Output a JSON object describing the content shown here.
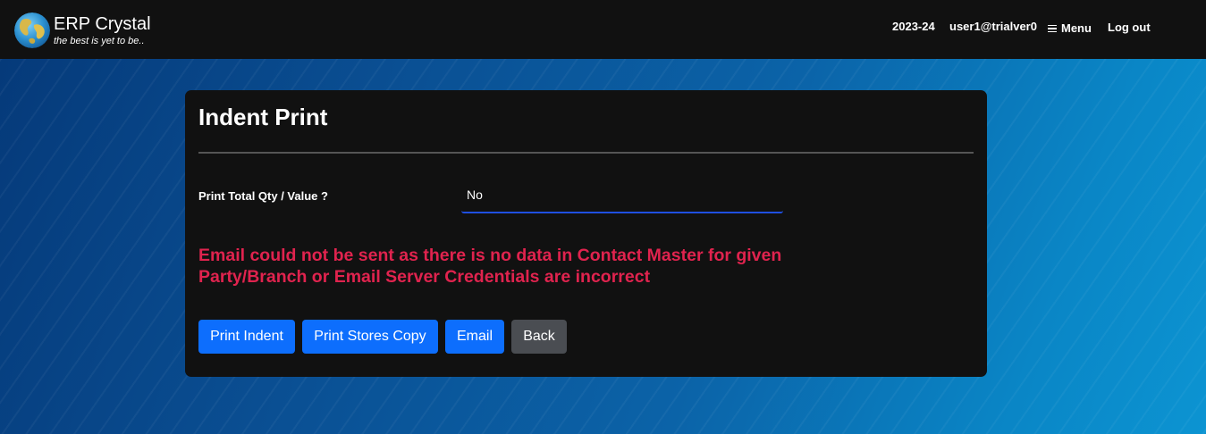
{
  "header": {
    "brand_title": "ERP Crystal",
    "brand_tagline": "the best is yet to be..",
    "logo_icon": "globe-icon",
    "financial_year": "2023-24",
    "user": "user1@trialver0",
    "menu_label": "Menu",
    "menu_icon": "hamburger-icon",
    "logout_label": "Log out"
  },
  "card": {
    "title": "Indent Print",
    "field": {
      "label": "Print Total Qty / Value ?",
      "value": "No"
    },
    "error_message": "Email could not be sent as there is no data in Contact Master for given Party/Branch or Email Server Credentials are incorrect",
    "buttons": {
      "print_indent": "Print Indent",
      "print_stores_copy": "Print Stores Copy",
      "email": "Email",
      "back": "Back"
    }
  },
  "colors": {
    "navbar_bg": "#111111",
    "card_bg": "#111111",
    "primary_button": "#0d6efd",
    "secondary_button": "#4a4d52",
    "error_text": "#e0234e",
    "select_underline": "#1f4fe0"
  }
}
